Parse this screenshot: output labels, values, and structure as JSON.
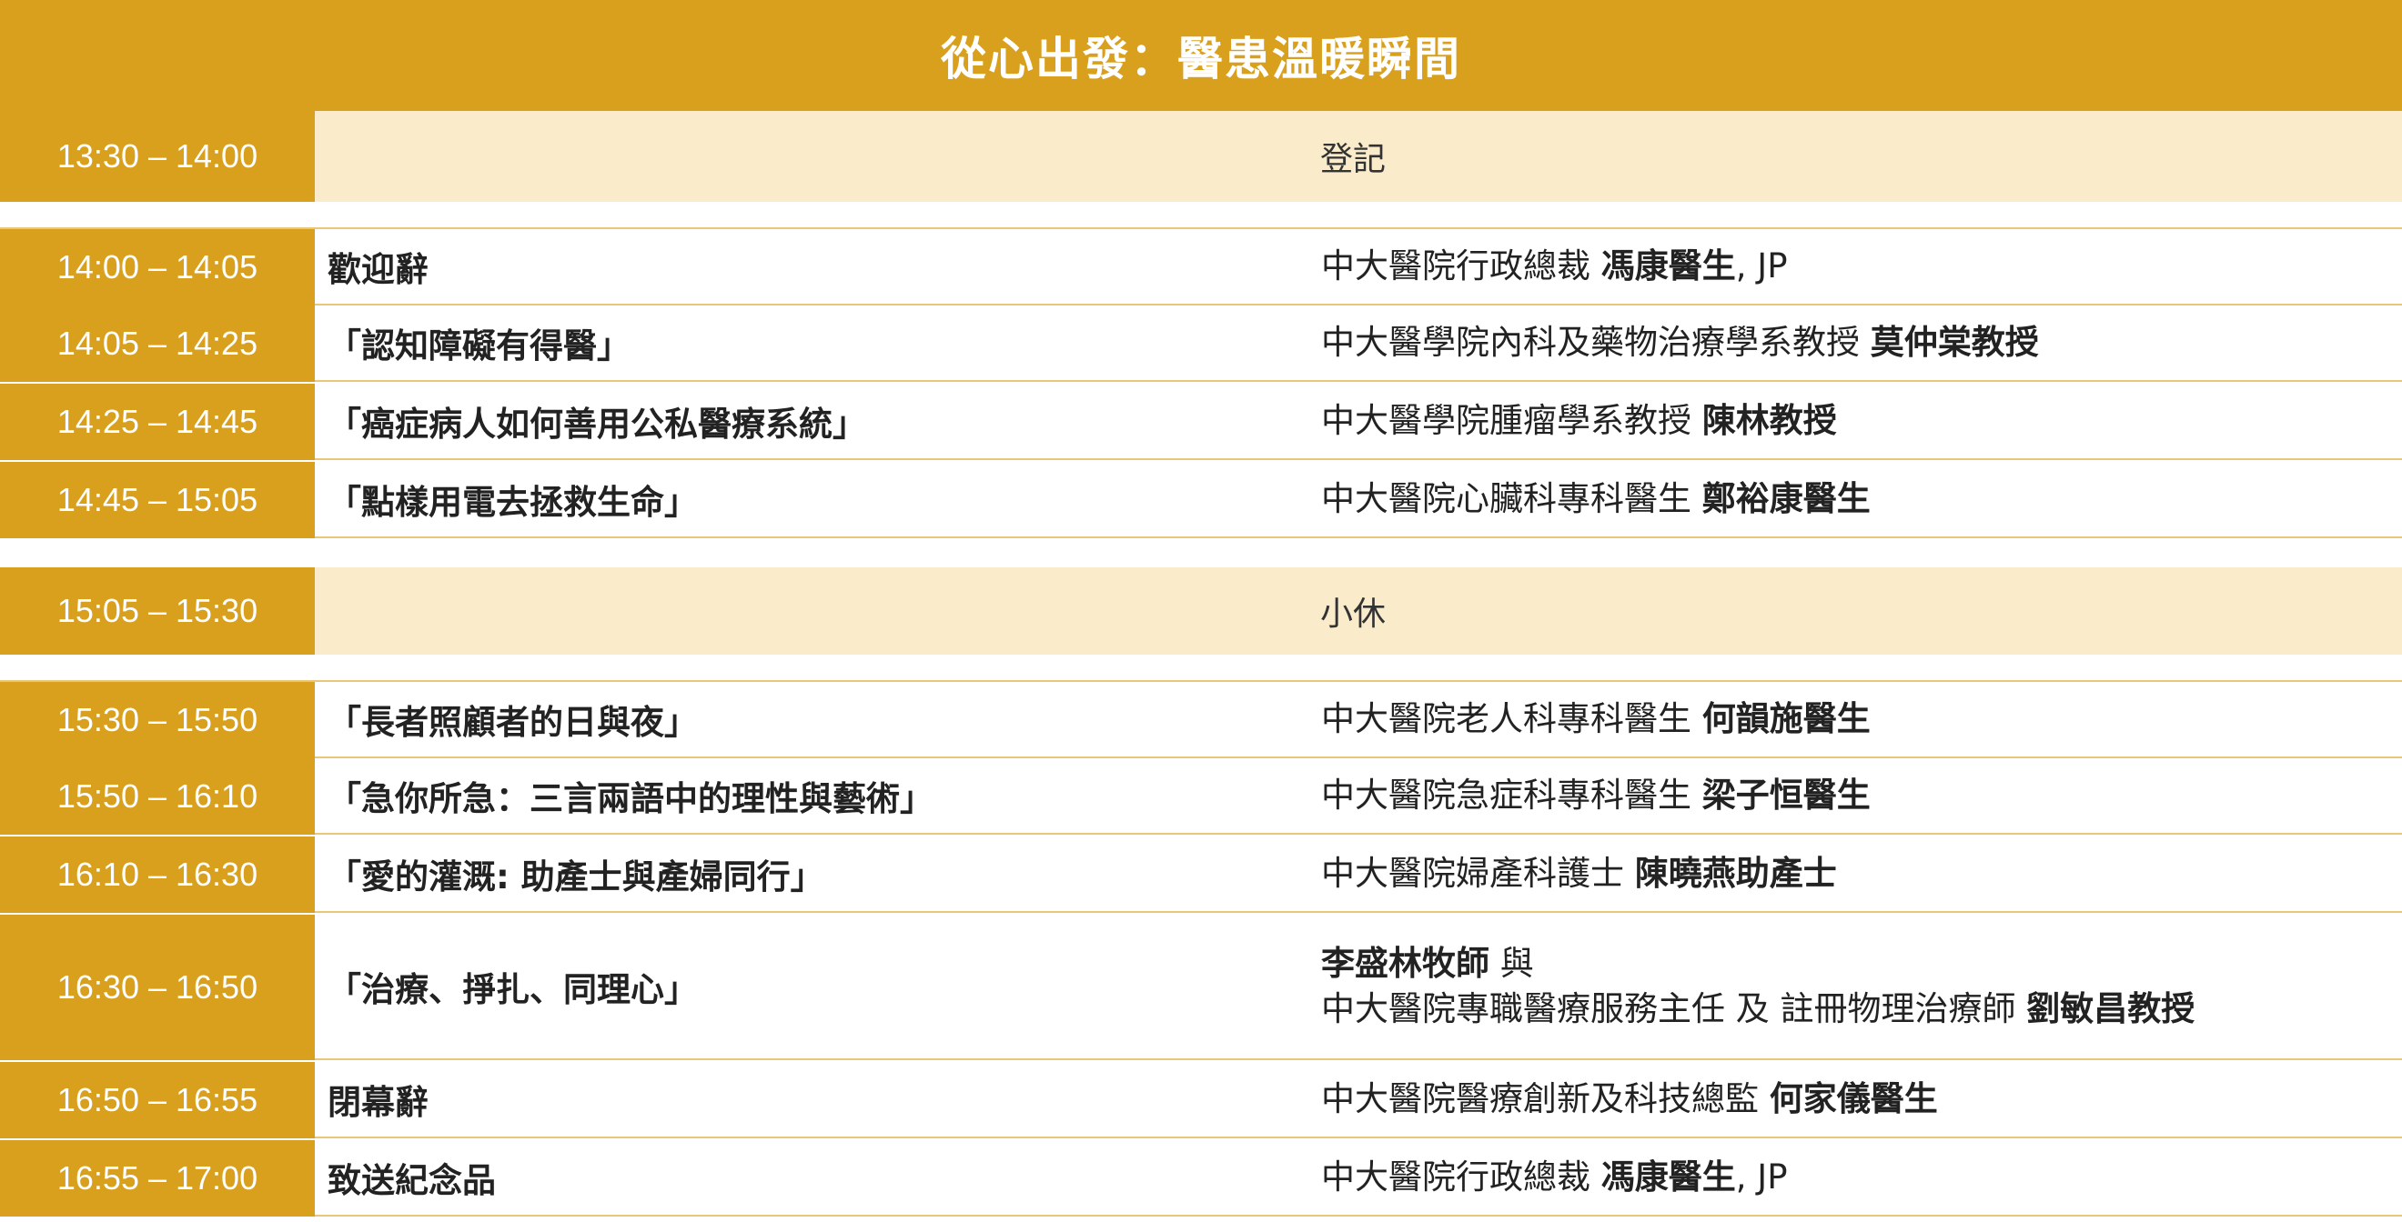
{
  "title": "從心出發：醫患溫暖瞬間",
  "colors": {
    "gold": "#D8A01C",
    "beige": "#FAEBCB",
    "divider": "#E8C77A"
  },
  "rows": [
    {
      "time": "13:30 – 14:00",
      "break_label": "登記"
    },
    {
      "time": "14:00 – 14:05",
      "topic": "歡迎辭",
      "speaker_pre": "中大醫院行政總裁 ",
      "speaker_name": "馮康醫生",
      "speaker_post": ", JP"
    },
    {
      "time": "14:05 – 14:25",
      "topic": "「認知障礙有得醫」",
      "speaker_pre": "中大醫學院內科及藥物治療學系教授 ",
      "speaker_name": "莫仲棠教授"
    },
    {
      "time": "14:25 – 14:45",
      "topic": "「癌症病人如何善用公私醫療系統」",
      "speaker_pre": "中大醫學院腫瘤學系教授 ",
      "speaker_name": "陳林教授"
    },
    {
      "time": "14:45 – 15:05",
      "topic": "「點樣用電去拯救生命」",
      "speaker_pre": "中大醫院心臟科專科醫生 ",
      "speaker_name": "鄭裕康醫生"
    },
    {
      "time": "15:05 – 15:30",
      "break_label": "小休"
    },
    {
      "time": "15:30 – 15:50",
      "topic": "「長者照顧者的日與夜」",
      "speaker_pre": "中大醫院老人科專科醫生 ",
      "speaker_name": "何韻施醫生"
    },
    {
      "time": "15:50 – 16:10",
      "topic": "「急你所急：三言兩語中的理性與藝術」",
      "speaker_pre": "中大醫院急症科專科醫生 ",
      "speaker_name": "梁子恒醫生"
    },
    {
      "time": "16:10 – 16:30",
      "topic": "「愛的灌溉: 助產士與產婦同行」",
      "speaker_pre": "中大醫院婦產科護士 ",
      "speaker_name": "陳曉燕助產士"
    },
    {
      "time": "16:30 – 16:50",
      "topic": "「治療、掙扎、同理心」",
      "speaker_line1_name": "李盛林牧師",
      "speaker_line1_post": " 與",
      "speaker_pre": "中大醫院專職醫療服務主任 及 註冊物理治療師 ",
      "speaker_name": "劉敏昌教授"
    },
    {
      "time": "16:50 – 16:55",
      "topic": "閉幕辭",
      "speaker_pre": "中大醫院醫療創新及科技總監 ",
      "speaker_name": "何家儀醫生"
    },
    {
      "time": "16:55 – 17:00",
      "topic": "致送紀念品",
      "speaker_pre": "中大醫院行政總裁 ",
      "speaker_name": "馮康醫生",
      "speaker_post": ", JP"
    }
  ]
}
